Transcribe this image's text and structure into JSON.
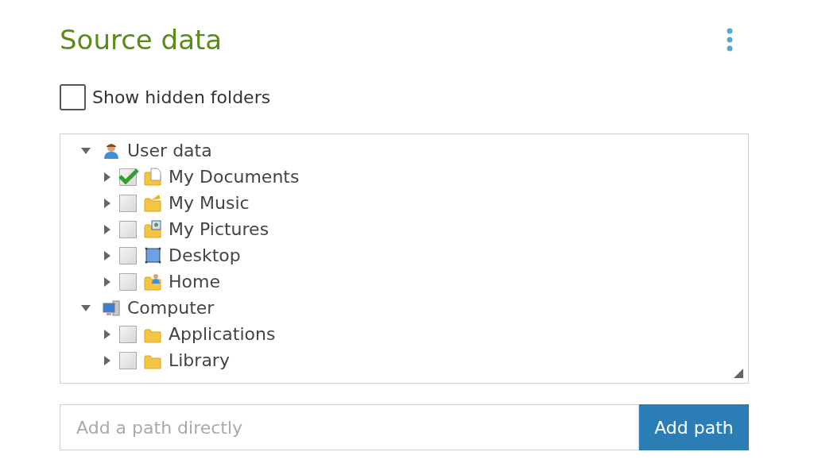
{
  "title": "Source data",
  "show_hidden_folders": {
    "label": "Show hidden folders",
    "checked": false
  },
  "tree": [
    {
      "label": "User data",
      "expanded": true,
      "children": [
        {
          "label": "My Documents",
          "expanded": false,
          "checked": true
        },
        {
          "label": "My Music",
          "expanded": false,
          "checked": false
        },
        {
          "label": "My Pictures",
          "expanded": false,
          "checked": false
        },
        {
          "label": "Desktop",
          "expanded": false,
          "checked": false
        },
        {
          "label": "Home",
          "expanded": false,
          "checked": false
        }
      ]
    },
    {
      "label": "Computer",
      "expanded": true,
      "children": [
        {
          "label": "Applications",
          "expanded": false,
          "checked": false
        },
        {
          "label": "Library",
          "expanded": false,
          "checked": false
        }
      ]
    }
  ],
  "path_field": {
    "placeholder": "Add a path directly"
  },
  "add_button": "Add path"
}
